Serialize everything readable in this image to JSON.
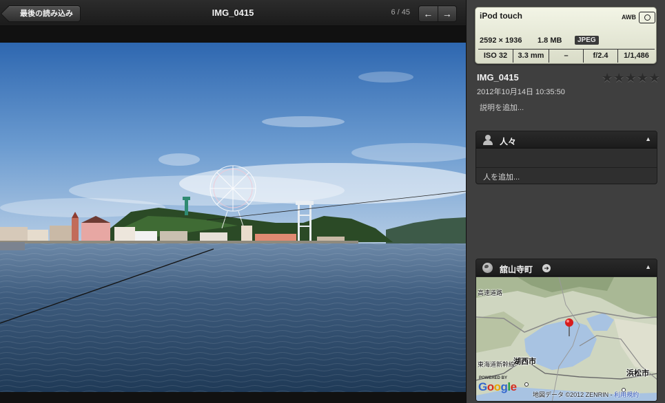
{
  "toolbar": {
    "back_label": "最後の読み込み",
    "title": "IMG_0415",
    "counter": "6 / 45",
    "prev_glyph": "←",
    "next_glyph": "→"
  },
  "camera": {
    "model": "iPod touch",
    "white_balance": "AWB",
    "resolution": "2592 × 1936",
    "file_size": "1.8 MB",
    "format": "JPEG",
    "iso": "ISO 32",
    "focal_length": "3.3 mm",
    "exposure_bias": "–",
    "aperture": "f/2.4",
    "shutter": "1/1,486"
  },
  "info": {
    "name": "IMG_0415",
    "date": "2012年10月14日 10:35:50",
    "add_description": "説明を追加...",
    "rating": 0,
    "rating_max": 5,
    "star_glyph": "★"
  },
  "people": {
    "title": "人々",
    "add_person": "人を追加...",
    "collapse_glyph": "▲"
  },
  "place": {
    "title": "舘山寺町",
    "arrow_glyph": "➜",
    "collapse_glyph": "▲",
    "labels": {
      "road1": "高速道路",
      "road2": "東海道新幹線",
      "city1": "湖西市",
      "city2": "浜松市"
    },
    "powered_by": "POWERED BY",
    "credit": "地図データ ©2012 ZENRIN - ",
    "terms_link": "利用規約"
  },
  "colors": {
    "panel_bg": "#3f3f3f",
    "camera_card": "#eceedd",
    "map_pin": "#d81c1c",
    "google_blue": "#3366cc",
    "google_red": "#d62d20",
    "google_yellow": "#e8a300",
    "google_green": "#1f9a3d"
  }
}
